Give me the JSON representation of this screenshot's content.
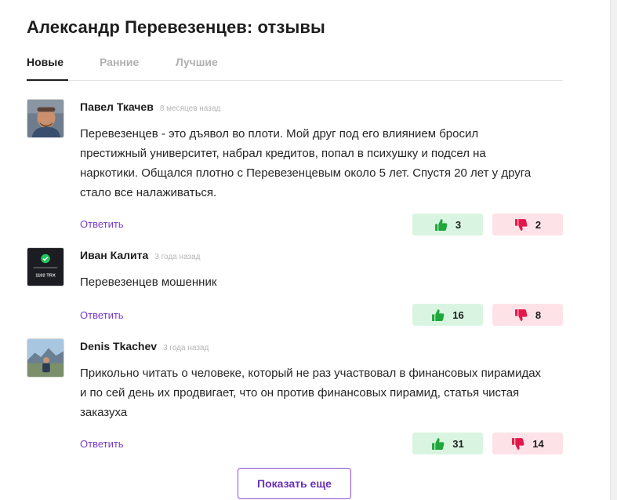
{
  "page": {
    "title": "Александр Перевезенцев: отзывы"
  },
  "tabs": [
    {
      "label": "Новые",
      "active": true
    },
    {
      "label": "Ранние",
      "active": false
    },
    {
      "label": "Лучшие",
      "active": false
    }
  ],
  "reviews": [
    {
      "author": "Павел Ткачев",
      "date": "8 месяцев назад",
      "text": "Перевезенцев - это дъявол во плоти. Мой друг под его влиянием бросил престижный университет, набрал кредитов, попал в психушку и подсел на наркотики. Общался плотно с Перевезенцевым около 5 лет. Спустя 20 лет у друга стало все налаживаться.",
      "reply_label": "Ответить",
      "likes": "3",
      "dislikes": "2"
    },
    {
      "author": "Иван Калита",
      "date": "3 года назад",
      "text": "Перевезенцев мошенник",
      "reply_label": "Ответить",
      "likes": "16",
      "dislikes": "8",
      "avatar_text": "1102 TRX"
    },
    {
      "author": "Denis Tkachev",
      "date": "3 года назад",
      "text": "Прикольно читать о человеке, который не раз участвовал в финансовых пирамидах и по сей день их продвигает, что он против финансовых пирамид, статья чистая заказуха",
      "reply_label": "Ответить",
      "likes": "31",
      "dislikes": "14"
    }
  ],
  "show_more": {
    "label": "Показать еще"
  },
  "colors": {
    "accent": "#7a3cc8",
    "like_bg": "#d9f5e1",
    "like_icon": "#1fa83a",
    "dislike_bg": "#fde3e8",
    "dislike_icon": "#e3174a"
  }
}
